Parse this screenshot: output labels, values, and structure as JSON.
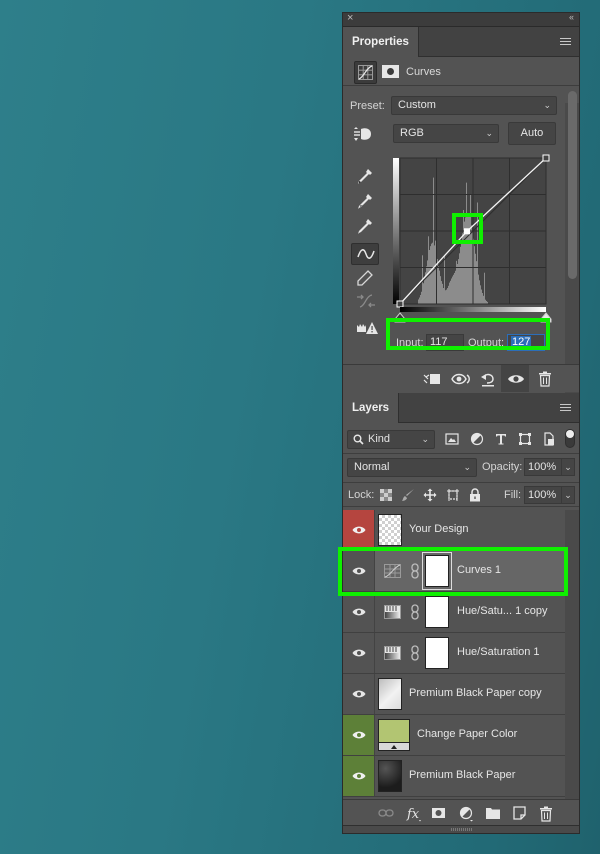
{
  "dock": {
    "close_glyph": "×",
    "collapse_glyph": "‹‹"
  },
  "properties": {
    "tab_label": "Properties",
    "adjustment_title": "Curves",
    "preset_label": "Preset:",
    "preset_value": "Custom",
    "channel_value": "RGB",
    "auto_label": "Auto",
    "input_label": "Input:",
    "input_value": "117",
    "output_label": "Output:",
    "output_value": "127",
    "curve": {
      "points": [
        [
          0,
          0
        ],
        [
          117,
          127
        ],
        [
          255,
          255
        ]
      ],
      "selected_point": [
        117,
        127
      ],
      "range": [
        0,
        255
      ]
    },
    "tools": [
      "target-adjust",
      "sample-black-point",
      "sample-gray-point",
      "sample-white-point",
      "edit-points",
      "draw-pencil",
      "smooth-curve",
      "clipping-warning"
    ],
    "footer_buttons": [
      "clip-to-layer",
      "view-previous-state",
      "reset-to-defaults",
      "toggle-visibility",
      "delete-adjustment"
    ]
  },
  "layers": {
    "tab_label": "Layers",
    "filter_kind": "Kind",
    "blend_mode": "Normal",
    "opacity_label": "Opacity:",
    "opacity_value": "100%",
    "lock_label": "Lock:",
    "fill_label": "Fill:",
    "fill_value": "100%",
    "items": [
      {
        "name": "Your Design",
        "visible": true,
        "eye_color": "red",
        "type": "smart-object",
        "selected": false
      },
      {
        "name": "Curves 1",
        "visible": true,
        "eye_color": "none",
        "type": "curves-adjustment",
        "selected": true
      },
      {
        "name": "Hue/Satu... 1 copy",
        "visible": true,
        "eye_color": "none",
        "type": "hue-saturation-adjustment",
        "selected": false
      },
      {
        "name": "Hue/Saturation 1",
        "visible": true,
        "eye_color": "none",
        "type": "hue-saturation-adjustment",
        "selected": false
      },
      {
        "name": "Premium Black Paper copy",
        "visible": true,
        "eye_color": "none",
        "type": "image",
        "selected": false
      },
      {
        "name": "Change Paper Color",
        "visible": true,
        "eye_color": "green",
        "type": "solid-color-fill",
        "selected": false
      },
      {
        "name": "Premium Black Paper",
        "visible": true,
        "eye_color": "green",
        "type": "image",
        "selected": false
      }
    ],
    "footer_buttons": [
      "link-layers",
      "add-layer-style",
      "add-mask",
      "new-fill-adjustment",
      "new-group",
      "new-layer",
      "delete-layer"
    ]
  },
  "colors": {
    "highlight": "#0ff000",
    "eye_red": "#b5453f",
    "eye_green": "#5d8038",
    "fill_layer_color": "#b2c572",
    "selection_blue": "#2c6eb9"
  }
}
